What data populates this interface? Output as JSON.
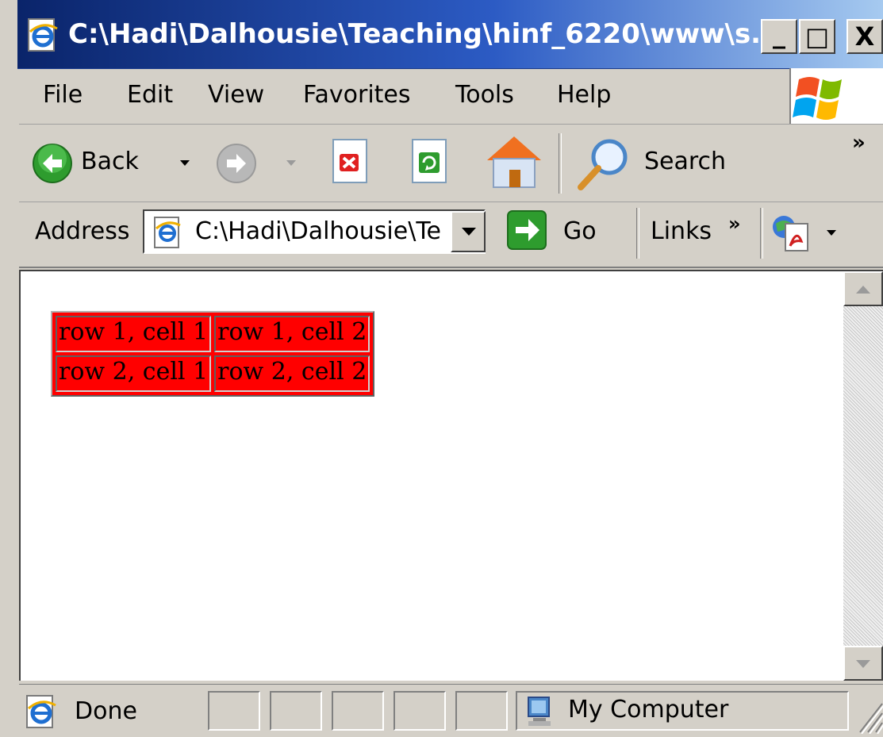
{
  "window": {
    "title": "C:\\Hadi\\Dalhousie\\Teaching\\hinf_6220\\www\\s...",
    "minimize": "_",
    "maximize": "□",
    "close": "X"
  },
  "menu": {
    "file": "File",
    "edit": "Edit",
    "view": "View",
    "favorites": "Favorites",
    "tools": "Tools",
    "help": "Help"
  },
  "toolbar": {
    "back_label": "Back",
    "search_label": "Search",
    "chevron": "»"
  },
  "address": {
    "label": "Address",
    "value": "C:\\Hadi\\Dalhousie\\Te",
    "go_label": "Go",
    "links_label": "Links",
    "links_chevron": "»"
  },
  "content": {
    "table": {
      "rows": [
        [
          "row 1, cell 1",
          "row 1, cell 2"
        ],
        [
          "row 2, cell 1",
          "row 2, cell 2"
        ]
      ],
      "background_color": "#ff0000"
    }
  },
  "status": {
    "text": "Done",
    "zone": "My Computer"
  },
  "colors": {
    "titlebar_start": "#0a246a",
    "titlebar_end": "#a6caf0",
    "chrome": "#d4d0c8"
  }
}
